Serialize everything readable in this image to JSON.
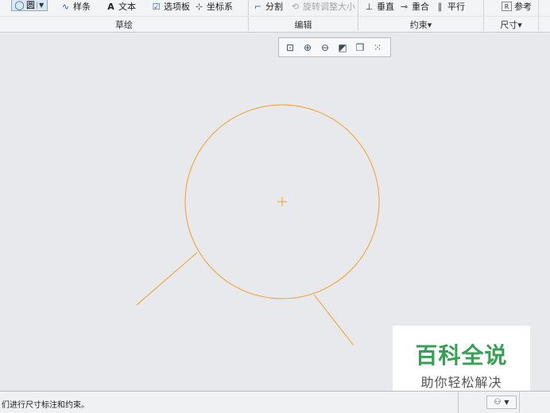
{
  "ribbon": {
    "sketch": {
      "circle_label": "圆",
      "spline_label": "样条",
      "text_label": "文本",
      "palette_label": "选项板",
      "coord_label": "坐标系",
      "group_label": "草绘"
    },
    "edit": {
      "divide_label": "分割",
      "rotate_resize_label": "旋转调整大小",
      "group_label": "编辑"
    },
    "constrain": {
      "perpendicular_label": "垂直",
      "coincident_label": "重合",
      "parallel_label": "平行",
      "group_label": "约束▾"
    },
    "dimension": {
      "reference_label": "参考",
      "group_label": "尺寸▾"
    }
  },
  "status": {
    "message": "们进行尺寸标注和约束。"
  },
  "watermark": {
    "main": "百科全说",
    "sub": "助你轻松解决"
  },
  "colors": {
    "sketch_line": "#f0a020",
    "watermark_green": "#36a154"
  }
}
